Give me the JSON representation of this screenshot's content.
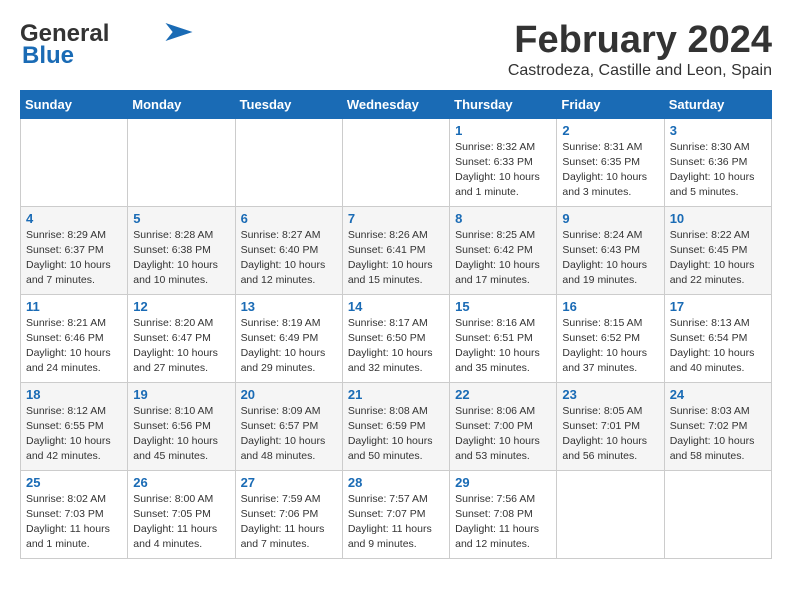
{
  "header": {
    "logo_line1": "General",
    "logo_line2": "Blue",
    "month_year": "February 2024",
    "location": "Castrodeza, Castille and Leon, Spain"
  },
  "days_of_week": [
    "Sunday",
    "Monday",
    "Tuesday",
    "Wednesday",
    "Thursday",
    "Friday",
    "Saturday"
  ],
  "weeks": [
    [
      {
        "day": "",
        "info": ""
      },
      {
        "day": "",
        "info": ""
      },
      {
        "day": "",
        "info": ""
      },
      {
        "day": "",
        "info": ""
      },
      {
        "day": "1",
        "info": "Sunrise: 8:32 AM\nSunset: 6:33 PM\nDaylight: 10 hours\nand 1 minute."
      },
      {
        "day": "2",
        "info": "Sunrise: 8:31 AM\nSunset: 6:35 PM\nDaylight: 10 hours\nand 3 minutes."
      },
      {
        "day": "3",
        "info": "Sunrise: 8:30 AM\nSunset: 6:36 PM\nDaylight: 10 hours\nand 5 minutes."
      }
    ],
    [
      {
        "day": "4",
        "info": "Sunrise: 8:29 AM\nSunset: 6:37 PM\nDaylight: 10 hours\nand 7 minutes."
      },
      {
        "day": "5",
        "info": "Sunrise: 8:28 AM\nSunset: 6:38 PM\nDaylight: 10 hours\nand 10 minutes."
      },
      {
        "day": "6",
        "info": "Sunrise: 8:27 AM\nSunset: 6:40 PM\nDaylight: 10 hours\nand 12 minutes."
      },
      {
        "day": "7",
        "info": "Sunrise: 8:26 AM\nSunset: 6:41 PM\nDaylight: 10 hours\nand 15 minutes."
      },
      {
        "day": "8",
        "info": "Sunrise: 8:25 AM\nSunset: 6:42 PM\nDaylight: 10 hours\nand 17 minutes."
      },
      {
        "day": "9",
        "info": "Sunrise: 8:24 AM\nSunset: 6:43 PM\nDaylight: 10 hours\nand 19 minutes."
      },
      {
        "day": "10",
        "info": "Sunrise: 8:22 AM\nSunset: 6:45 PM\nDaylight: 10 hours\nand 22 minutes."
      }
    ],
    [
      {
        "day": "11",
        "info": "Sunrise: 8:21 AM\nSunset: 6:46 PM\nDaylight: 10 hours\nand 24 minutes."
      },
      {
        "day": "12",
        "info": "Sunrise: 8:20 AM\nSunset: 6:47 PM\nDaylight: 10 hours\nand 27 minutes."
      },
      {
        "day": "13",
        "info": "Sunrise: 8:19 AM\nSunset: 6:49 PM\nDaylight: 10 hours\nand 29 minutes."
      },
      {
        "day": "14",
        "info": "Sunrise: 8:17 AM\nSunset: 6:50 PM\nDaylight: 10 hours\nand 32 minutes."
      },
      {
        "day": "15",
        "info": "Sunrise: 8:16 AM\nSunset: 6:51 PM\nDaylight: 10 hours\nand 35 minutes."
      },
      {
        "day": "16",
        "info": "Sunrise: 8:15 AM\nSunset: 6:52 PM\nDaylight: 10 hours\nand 37 minutes."
      },
      {
        "day": "17",
        "info": "Sunrise: 8:13 AM\nSunset: 6:54 PM\nDaylight: 10 hours\nand 40 minutes."
      }
    ],
    [
      {
        "day": "18",
        "info": "Sunrise: 8:12 AM\nSunset: 6:55 PM\nDaylight: 10 hours\nand 42 minutes."
      },
      {
        "day": "19",
        "info": "Sunrise: 8:10 AM\nSunset: 6:56 PM\nDaylight: 10 hours\nand 45 minutes."
      },
      {
        "day": "20",
        "info": "Sunrise: 8:09 AM\nSunset: 6:57 PM\nDaylight: 10 hours\nand 48 minutes."
      },
      {
        "day": "21",
        "info": "Sunrise: 8:08 AM\nSunset: 6:59 PM\nDaylight: 10 hours\nand 50 minutes."
      },
      {
        "day": "22",
        "info": "Sunrise: 8:06 AM\nSunset: 7:00 PM\nDaylight: 10 hours\nand 53 minutes."
      },
      {
        "day": "23",
        "info": "Sunrise: 8:05 AM\nSunset: 7:01 PM\nDaylight: 10 hours\nand 56 minutes."
      },
      {
        "day": "24",
        "info": "Sunrise: 8:03 AM\nSunset: 7:02 PM\nDaylight: 10 hours\nand 58 minutes."
      }
    ],
    [
      {
        "day": "25",
        "info": "Sunrise: 8:02 AM\nSunset: 7:03 PM\nDaylight: 11 hours\nand 1 minute."
      },
      {
        "day": "26",
        "info": "Sunrise: 8:00 AM\nSunset: 7:05 PM\nDaylight: 11 hours\nand 4 minutes."
      },
      {
        "day": "27",
        "info": "Sunrise: 7:59 AM\nSunset: 7:06 PM\nDaylight: 11 hours\nand 7 minutes."
      },
      {
        "day": "28",
        "info": "Sunrise: 7:57 AM\nSunset: 7:07 PM\nDaylight: 11 hours\nand 9 minutes."
      },
      {
        "day": "29",
        "info": "Sunrise: 7:56 AM\nSunset: 7:08 PM\nDaylight: 11 hours\nand 12 minutes."
      },
      {
        "day": "",
        "info": ""
      },
      {
        "day": "",
        "info": ""
      }
    ]
  ]
}
